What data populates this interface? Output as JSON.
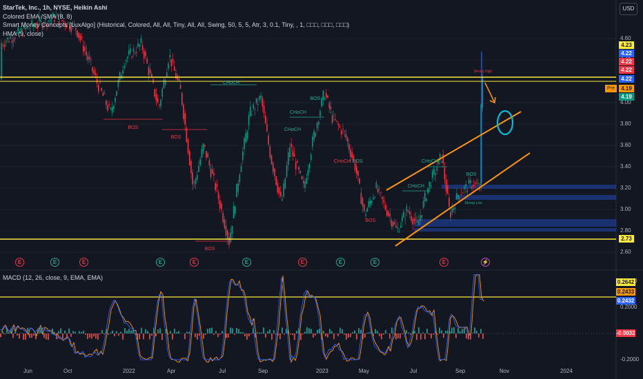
{
  "legend": {
    "title": "StarTek, Inc., 1h, NYSE, Heikin Ashi",
    "line2": "Colored EMA /SMA (8, 8)",
    "line3": "Smart Money Concepts [LuxAlgo] (Historical, Colored, All, All, Tiny, All, All, Swing, 50, 5, 5, Atr, 3, 0.1, Tiny, , 1, □□□, □□□, □□□)",
    "line4": "HMA (9, close)"
  },
  "currency": "USD",
  "macd_legend": "MACD (12, 26, close, 9, EMA, EMA)",
  "price_ticks": [
    "4.60",
    "4.40",
    "4.20",
    "4.00",
    "3.80",
    "3.60",
    "3.40",
    "3.20",
    "3.00",
    "2.80",
    "2.60"
  ],
  "macd_ticks": [
    "0.4000",
    "0.2000",
    "-0.2000"
  ],
  "price_badges": [
    {
      "label": "4.23",
      "bg": "#ffeb3b",
      "fg": "#131722"
    },
    {
      "label": "4.22",
      "bg": "#2962ff",
      "fg": "#ffffff"
    },
    {
      "label": "4.22",
      "bg": "#f23645",
      "fg": "#ffffff"
    },
    {
      "label": "4.22",
      "bg": "#f23645",
      "fg": "#ffffff"
    },
    {
      "label": "4.22",
      "bg": "#2962ff",
      "fg": "#ffffff"
    },
    {
      "label": "4.19",
      "bg": "#ff9800",
      "fg": "#131722"
    },
    {
      "label": "4.19",
      "bg": "#089981",
      "fg": "#ffffff"
    },
    {
      "label": "2.73",
      "bg": "#ffeb3b",
      "fg": "#131722"
    }
  ],
  "pre_label": "Pre",
  "macd_badges": [
    {
      "label": "0.2642",
      "bg": "#ffeb3b",
      "fg": "#131722"
    },
    {
      "label": "0.2433",
      "bg": "#ff9800",
      "fg": "#131722"
    },
    {
      "label": "0.2432",
      "bg": "#2962ff",
      "fg": "#ffffff"
    },
    {
      "label": "-0.0032",
      "bg": "#f23645",
      "fg": "#ffffff"
    }
  ],
  "time_axis": [
    "Jun",
    "Oct",
    "2022",
    "Apr",
    "Jul",
    "Sep",
    "2023",
    "May",
    "Jul",
    "Sep",
    "Nov",
    "2024"
  ],
  "smc_labels": [
    "BOS",
    "BOS",
    "BOS",
    "CHoCH",
    "CHoCH",
    "CHoCH",
    "BOS",
    "CHoCH",
    "CHoCH",
    "BOS",
    "CHoCH",
    "BOS",
    "BOS",
    "Strong High",
    "Strong Low"
  ],
  "earnings_markers": [
    {
      "type": "red",
      "glyph": "E"
    },
    {
      "type": "green",
      "glyph": "E"
    },
    {
      "type": "red",
      "glyph": "E"
    },
    {
      "type": "green",
      "glyph": "E"
    },
    {
      "type": "red",
      "glyph": "E"
    },
    {
      "type": "green",
      "glyph": "E"
    },
    {
      "type": "red",
      "glyph": "E"
    },
    {
      "type": "green",
      "glyph": "E"
    },
    {
      "type": "green",
      "glyph": "E"
    },
    {
      "type": "red",
      "glyph": "E"
    },
    {
      "type": "purple",
      "glyph": "⚡"
    }
  ],
  "colors": {
    "background": "#131722",
    "up": "#089981",
    "down": "#f23645",
    "level": "#ffeb3b",
    "channel": "#ff9800",
    "circle": "#00bcd4",
    "macd_line": "#2962ff",
    "signal_line": "#ff9800"
  }
}
